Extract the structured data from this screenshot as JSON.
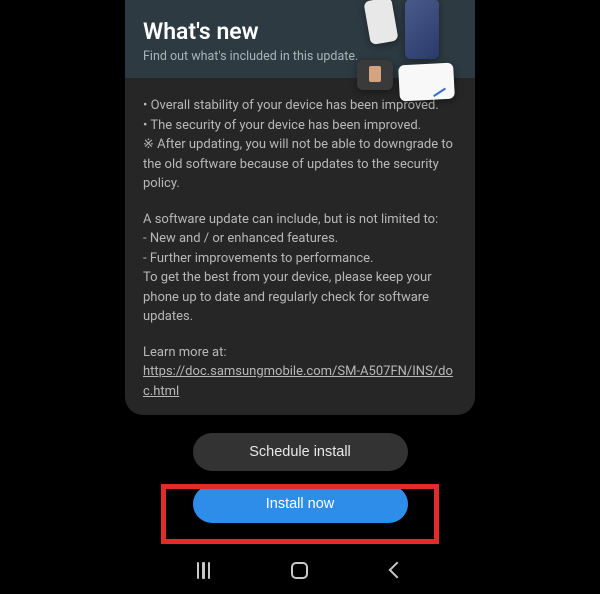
{
  "header": {
    "title": "What's new",
    "subtitle": "Find out what's included in this update."
  },
  "notes": {
    "bullets": "• Overall stability of your device has been improved.\n• The security of your device has been improved.\n※ After updating, you will not be able to downgrade to the old software because of updates to the security policy.",
    "info": "A software update can include, but is not limited to:\n - New and / or enhanced features.\n - Further improvements to performance.\nTo get the best from your device, please keep your phone up to date and regularly check for software updates.",
    "learn_label": "Learn more at:",
    "learn_url": "https://doc.samsungmobile.com/SM-A507FN/INS/doc.html"
  },
  "buttons": {
    "schedule": "Schedule install",
    "install": "Install now"
  }
}
